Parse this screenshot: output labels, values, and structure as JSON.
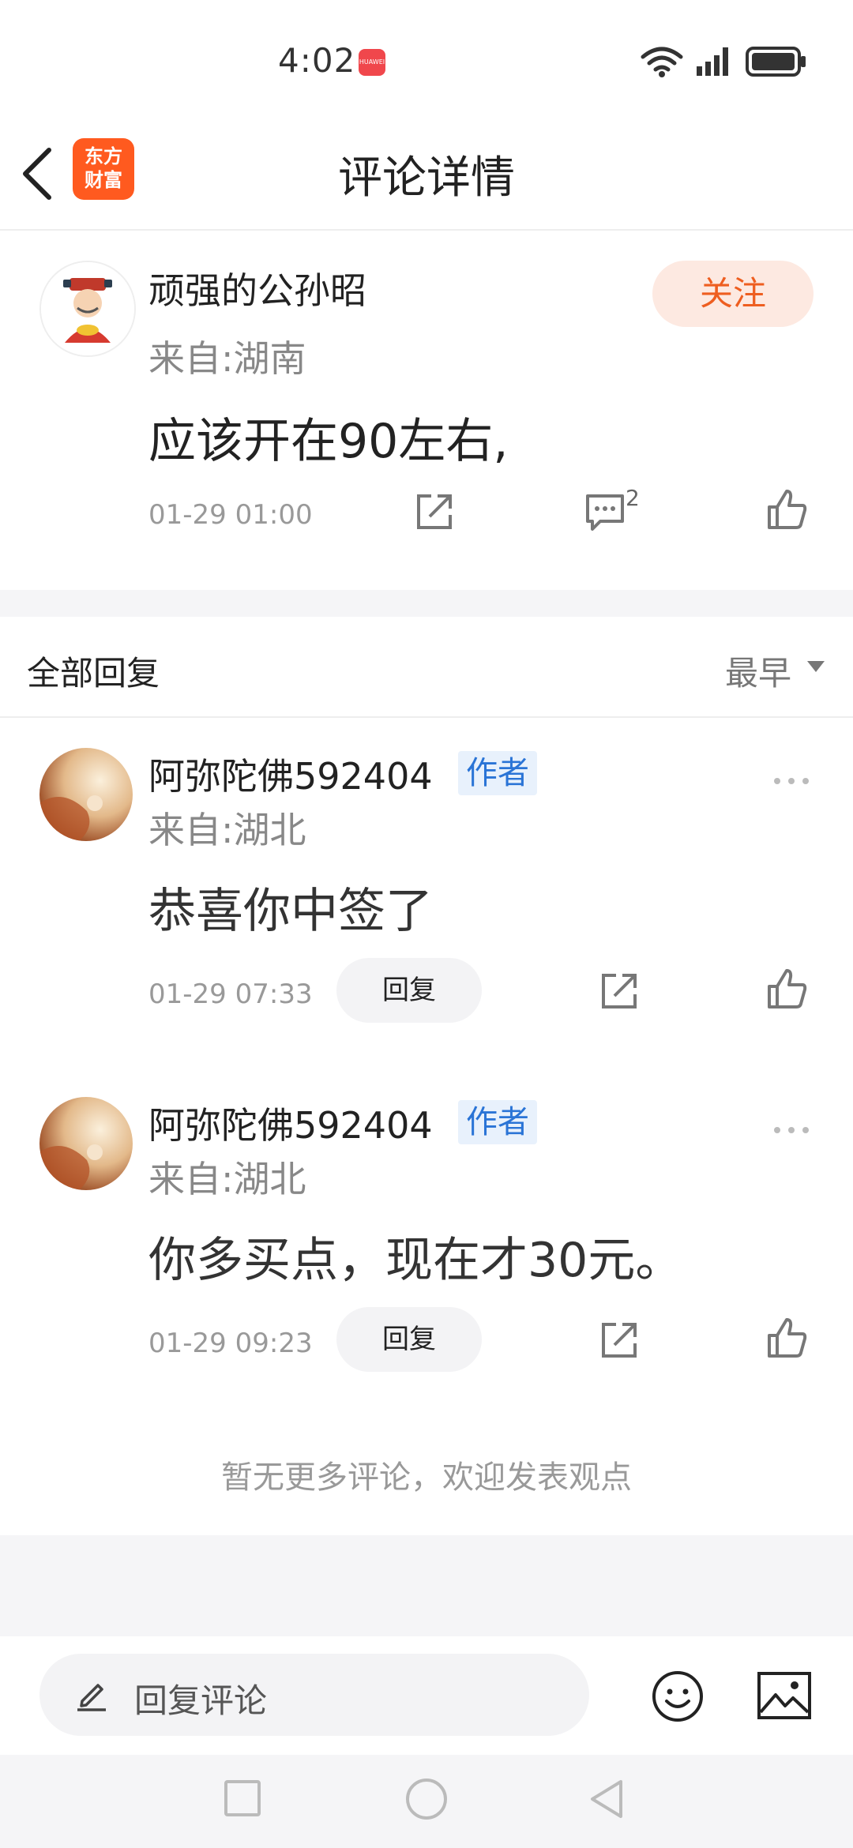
{
  "status_bar": {
    "time": "4:02",
    "badge": "HUAWEI"
  },
  "header": {
    "title": "评论详情",
    "logo_line1": "东方",
    "logo_line2": "财富"
  },
  "main_comment": {
    "username": "顽强的公孙昭",
    "location": "来自:湖南",
    "follow_label": "关注",
    "text": "应该开在90左右,",
    "time": "01-29 01:00",
    "comment_count": "2"
  },
  "replies_section": {
    "title": "全部回复",
    "sort": "最早"
  },
  "replies": [
    {
      "username": "阿弥陀佛592404",
      "badge": "作者",
      "location": "来自:湖北",
      "text": "恭喜你中签了",
      "time": "01-29 07:33",
      "reply_label": "回复"
    },
    {
      "username": "阿弥陀佛592404",
      "badge": "作者",
      "location": "来自:湖北",
      "text": "你多买点，现在才30元。",
      "time": "01-29 09:23",
      "reply_label": "回复"
    }
  ],
  "footer_note": "暂无更多评论，欢迎发表观点",
  "input_bar": {
    "placeholder": "回复评论"
  },
  "colors": {
    "accent": "#ee5e20",
    "author_badge": "#2a74d6"
  }
}
